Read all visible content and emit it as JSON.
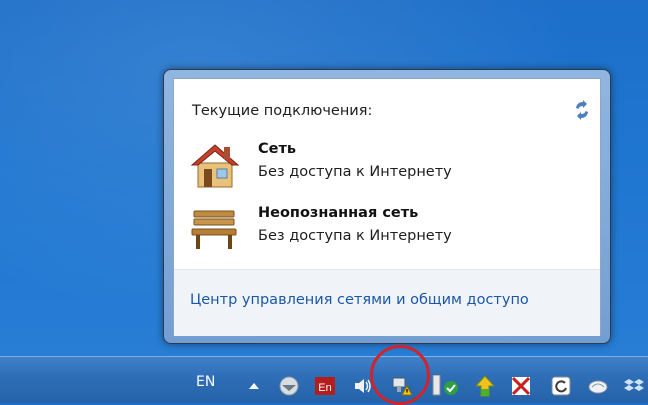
{
  "flyout": {
    "header": "Текущие подключения:",
    "networks": [
      {
        "name": "Сеть",
        "status": "Без доступа к Интернету",
        "icon": "home-network-icon"
      },
      {
        "name": "Неопознанная сеть",
        "status": "Без доступа к Интернету",
        "icon": "public-network-bench-icon"
      }
    ],
    "footer_link": "Центр управления сетями и общим доступо"
  },
  "taskbar": {
    "language": "EN",
    "tray_icons": [
      "show-hidden-icons-arrow",
      "network-globe-icon",
      "en-keyboard-icon",
      "volume-icon",
      "network-warning-icon",
      "security-check-icon",
      "update-arrow-icon",
      "flag-icon",
      "refresh-app-icon",
      "cloud-app-icon",
      "dropbox-icon"
    ]
  },
  "colors": {
    "desktop": "#1f76d0",
    "taskbar": "#2f6fb8",
    "link": "#1a57a8",
    "highlight": "#d2232a"
  }
}
